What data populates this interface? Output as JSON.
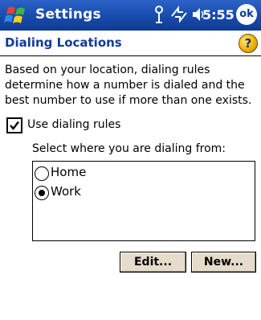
{
  "titlebar": {
    "title": "Settings",
    "time": "5:55",
    "ok_label": "ok"
  },
  "header": {
    "title": "Dialing Locations",
    "help_symbol": "?"
  },
  "description": "Based on your location, dialing rules determine how a number is dialed and the best number to use if more than one exists.",
  "use_dialing_rules": {
    "label": "Use dialing rules",
    "checked": true
  },
  "select_prompt": "Select where you are dialing from:",
  "locations": [
    {
      "label": "Home",
      "selected": false
    },
    {
      "label": "Work",
      "selected": true
    }
  ],
  "buttons": {
    "edit": "Edit...",
    "new": "New..."
  },
  "icons": {
    "start": "windows-flag-icon",
    "status": [
      "antenna-icon",
      "connectivity-arrows-icon",
      "speaker-icon"
    ],
    "ok": "ok-icon",
    "help": "help-icon"
  },
  "colors": {
    "titlebar": "#1b4fb0",
    "header_text": "#103b9c",
    "button_face": "#e6dccb"
  }
}
